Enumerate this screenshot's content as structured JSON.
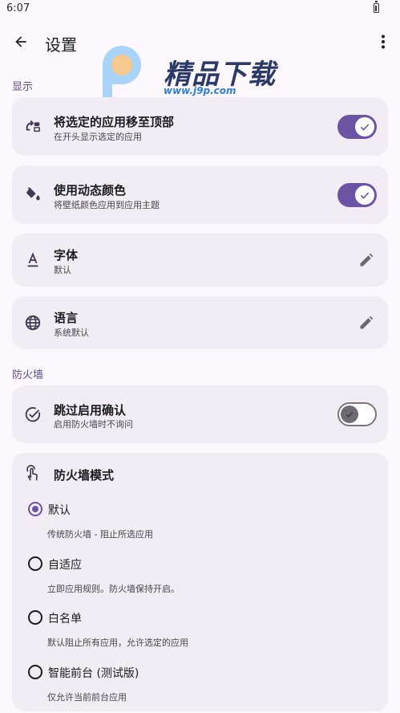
{
  "status_bar": {
    "time": "6:07"
  },
  "app_bar": {
    "title": "设置"
  },
  "watermark": {
    "brand": "精品下载",
    "url": "www.j9p.com"
  },
  "sections": {
    "display": "显示",
    "firewall": "防火墙"
  },
  "settings": {
    "pin_selected": {
      "title": "将选定的应用移至顶部",
      "subtitle": "在开头显示选定的应用",
      "enabled": true
    },
    "dynamic_color": {
      "title": "使用动态颜色",
      "subtitle": "将壁纸颜色应用到应用主题",
      "enabled": true
    },
    "font": {
      "title": "字体",
      "value": "默认"
    },
    "language": {
      "title": "语言",
      "value": "系统默认"
    },
    "skip_confirm": {
      "title": "跳过启用确认",
      "subtitle": "启用防火墙时不询问",
      "enabled": false
    }
  },
  "firewall_mode": {
    "title": "防火墙模式",
    "selected": "default",
    "options": [
      {
        "id": "default",
        "label": "默认",
        "description": "传统防火墙 - 阻止所选应用"
      },
      {
        "id": "adaptive",
        "label": "自适应",
        "description": "立即应用规则。防火墙保持开启。"
      },
      {
        "id": "whitelist",
        "label": "白名单",
        "description": "默认阻止所有应用，允许选定的应用"
      },
      {
        "id": "smart_foreground",
        "label": "智能前台 (测试版)",
        "description": "仅允许当前前台应用"
      }
    ]
  },
  "colors": {
    "accent": "#6a54a3",
    "card": "#f2ecf4",
    "background": "#fdf7fe"
  }
}
